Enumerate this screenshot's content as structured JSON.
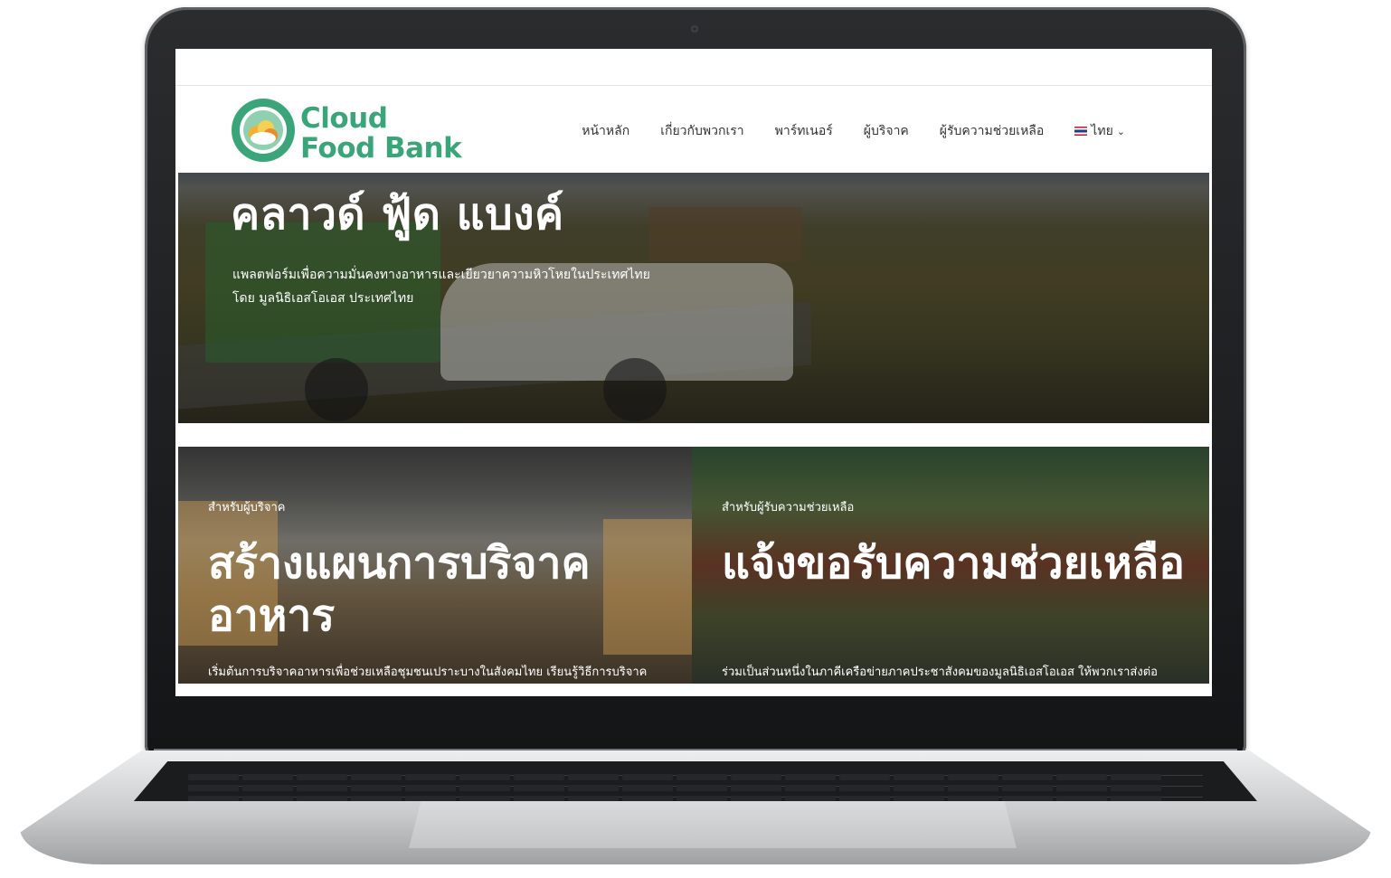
{
  "site": {
    "brand_line1": "Cloud",
    "brand_line2": "Food Bank",
    "accent_color": "#3ba57a"
  },
  "nav": {
    "items": [
      "หน้าหลัก",
      "เกี่ยวกับพวกเรา",
      "พาร์ทเนอร์",
      "ผู้บริจาค",
      "ผู้รับความช่วยเหลือ"
    ],
    "language": "ไทย"
  },
  "hero": {
    "title": "คลาวด์ ฟู้ด แบงค์",
    "subtitle_line1": "แพลตฟอร์มเพื่อความมั่นคงทางอาหารและเยียวยาความหิวโหยในประเทศไทย",
    "subtitle_line2": "โดย มูลนิธิเอสโอเอส ประเทศไทย"
  },
  "cards": [
    {
      "eyebrow": "สำหรับผู้บริจาค",
      "title": "สร้างแผนการบริจาคอาหาร",
      "description": "เริ่มต้นการบริจาคอาหารเพื่อช่วยเหลือชุมชนเปราะบางในสังคมไทย เรียนรู้วิธีการบริจาค"
    },
    {
      "eyebrow": "สำหรับผู้รับความช่วยเหลือ",
      "title": "แจ้งขอรับความช่วยเหลือ",
      "description": "ร่วมเป็นส่วนหนึ่งในภาคีเครือข่ายภาคประชาสังคมของมูลนิธิเอสโอเอส ให้พวกเราส่งต่อ"
    }
  ]
}
